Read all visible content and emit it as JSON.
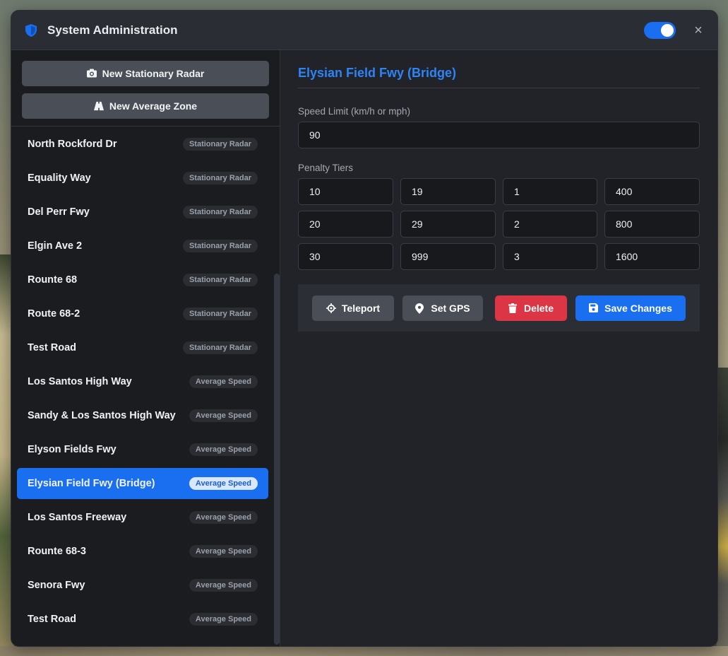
{
  "window": {
    "title": "System Administration",
    "toggle_on": true,
    "close_glyph": "×",
    "accent_color": "#1a6ff0"
  },
  "sidebar": {
    "actions": [
      {
        "label": "New Stationary Radar",
        "icon": "camera-icon"
      },
      {
        "label": "New Average Zone",
        "icon": "road-icon"
      }
    ],
    "items": [
      {
        "name": "North Rockford Dr",
        "type": "Stationary Radar"
      },
      {
        "name": "Equality Way",
        "type": "Stationary Radar"
      },
      {
        "name": "Del Perr Fwy",
        "type": "Stationary Radar"
      },
      {
        "name": "Elgin Ave 2",
        "type": "Stationary Radar"
      },
      {
        "name": "Rounte 68",
        "type": "Stationary Radar"
      },
      {
        "name": "Route 68-2",
        "type": "Stationary Radar"
      },
      {
        "name": "Test Road",
        "type": "Stationary Radar"
      },
      {
        "name": "Los Santos High Way",
        "type": "Average Speed"
      },
      {
        "name": "Sandy & Los Santos High Way",
        "type": "Average Speed"
      },
      {
        "name": "Elyson Fields Fwy",
        "type": "Average Speed"
      },
      {
        "name": "Elysian Field Fwy (Bridge)",
        "type": "Average Speed"
      },
      {
        "name": "Los Santos Freeway",
        "type": "Average Speed"
      },
      {
        "name": "Rounte 68-3",
        "type": "Average Speed"
      },
      {
        "name": "Senora Fwy",
        "type": "Average Speed"
      },
      {
        "name": "Test Road",
        "type": "Average Speed"
      }
    ],
    "selected_index": 10
  },
  "main": {
    "title": "Elysian Field Fwy (Bridge)",
    "speed_limit": {
      "label": "Speed Limit (km/h or mph)",
      "value": "90"
    },
    "penalty_tiers": {
      "label": "Penalty Tiers",
      "rows": [
        [
          "10",
          "19",
          "1",
          "400"
        ],
        [
          "20",
          "29",
          "2",
          "800"
        ],
        [
          "30",
          "999",
          "3",
          "1600"
        ]
      ]
    },
    "toolbar": {
      "teleport": "Teleport",
      "set_gps": "Set GPS",
      "delete": "Delete",
      "save": "Save Changes"
    }
  }
}
